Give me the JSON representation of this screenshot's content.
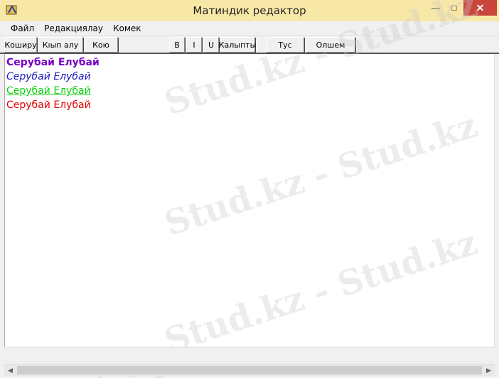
{
  "window": {
    "title": "Матиндик редактор",
    "min_glyph": "—",
    "max_glyph": "□",
    "close_glyph": "✕"
  },
  "menu": {
    "items": [
      "Файл",
      "Редакциялау",
      "Комек"
    ]
  },
  "toolbar": {
    "copy": "Коширу",
    "cut": "Кıып алу",
    "paste": "Кою",
    "bold": "B",
    "italic": "I",
    "underline": "U",
    "regular": "Калыпты",
    "color": "Тус",
    "size": "Олшем"
  },
  "editor": {
    "lines": [
      {
        "text": "Серубай Елубай",
        "color": "#7a00c8",
        "style": "bold"
      },
      {
        "text": "Серубай Елубай",
        "color": "#2020b8",
        "style": "italic"
      },
      {
        "text": "Серубай Елубай",
        "color": "#10d010",
        "style": "underline"
      },
      {
        "text": "Серубай Елубай",
        "color": "#e00000",
        "style": "regular"
      }
    ]
  },
  "watermark": {
    "text": "Stud.kz - Stud.kz"
  },
  "scrollbar": {
    "left_glyph": "◀",
    "right_glyph": "▶"
  }
}
